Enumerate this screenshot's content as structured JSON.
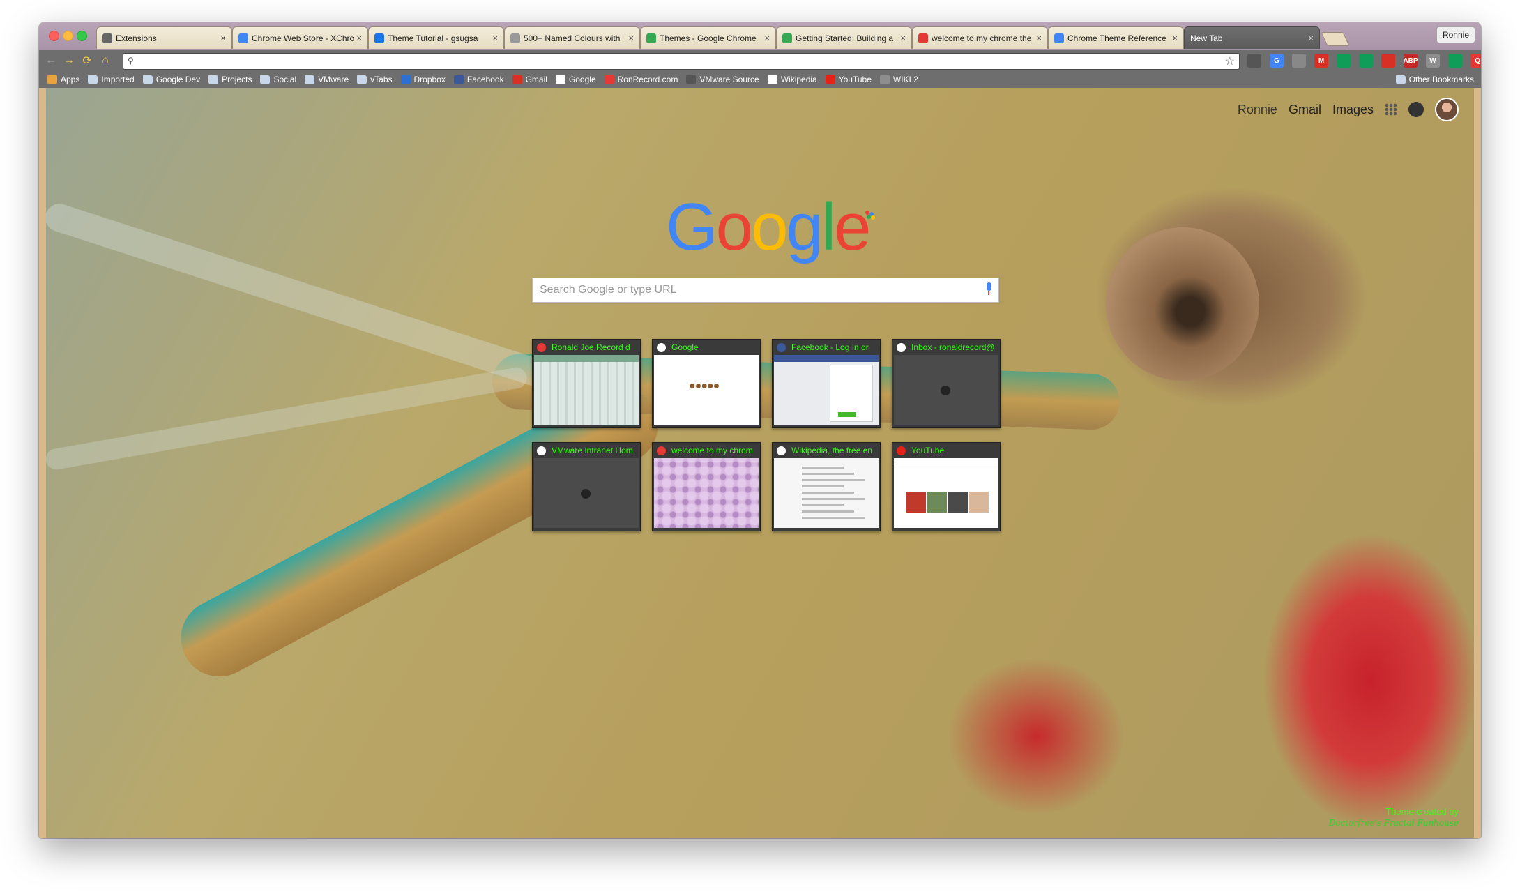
{
  "window": {
    "profile_label": "Ronnie",
    "tabs": [
      {
        "title": "Extensions",
        "favicon_icon": "puzzle-icon",
        "color": "#666666"
      },
      {
        "title": "Chrome Web Store - XChro",
        "favicon_icon": "chrome-icon",
        "color": "#4285f4"
      },
      {
        "title": "Theme Tutorial - gsugsa",
        "favicon_icon": "doc-icon",
        "color": "#1a73e8"
      },
      {
        "title": "500+ Named Colours with",
        "favicon_icon": "page-icon",
        "color": "#999999"
      },
      {
        "title": "Themes - Google Chrome",
        "favicon_icon": "google-icon",
        "color": "#34a853"
      },
      {
        "title": "Getting Started: Building a",
        "favicon_icon": "google-icon",
        "color": "#34a853"
      },
      {
        "title": "welcome to my chrome the",
        "favicon_icon": "record-icon",
        "color": "#e53935"
      },
      {
        "title": "Chrome Theme Reference",
        "favicon_icon": "doc-icon",
        "color": "#4285f4"
      },
      {
        "title": "New Tab",
        "favicon_icon": "",
        "color": "",
        "active": true
      }
    ]
  },
  "toolbar": {
    "omnibox_value": "",
    "extensions": [
      {
        "icon": "microphone-icon",
        "label": "",
        "color": "#555555"
      },
      {
        "icon": "translate-icon",
        "label": "G",
        "color": "#4285f4"
      },
      {
        "icon": "mail-icon",
        "label": "",
        "color": "#888888"
      },
      {
        "icon": "gmail-icon",
        "label": "M",
        "color": "#d93025"
      },
      {
        "icon": "drive-icon",
        "label": "",
        "color": "#0f9d58"
      },
      {
        "icon": "hangouts-icon",
        "label": "",
        "color": "#0f9d58"
      },
      {
        "icon": "clip-icon",
        "label": "",
        "color": "#d93025"
      },
      {
        "icon": "adblock-icon",
        "label": "ABP",
        "color": "#c62828"
      },
      {
        "icon": "word-icon",
        "label": "W",
        "color": "#8e8e8e"
      },
      {
        "icon": "sheets-icon",
        "label": "",
        "color": "#0f9d58"
      },
      {
        "icon": "search-ext-icon",
        "label": "Q",
        "color": "#e53935"
      },
      {
        "icon": "menu-icon",
        "label": "≡",
        "color": "#f0c44c"
      }
    ]
  },
  "bookmarks": {
    "items": [
      {
        "label": "Apps",
        "icon": "apps-grid-icon",
        "color": "#e8a33d"
      },
      {
        "label": "Imported",
        "icon": "folder-icon"
      },
      {
        "label": "Google Dev",
        "icon": "folder-icon"
      },
      {
        "label": "Projects",
        "icon": "folder-icon"
      },
      {
        "label": "Social",
        "icon": "folder-icon"
      },
      {
        "label": "VMware",
        "icon": "folder-icon"
      },
      {
        "label": "vTabs",
        "icon": "folder-icon"
      },
      {
        "label": "Dropbox",
        "icon": "dropbox-icon",
        "color": "#2e6fd3"
      },
      {
        "label": "Facebook",
        "icon": "facebook-icon",
        "color": "#3b5998"
      },
      {
        "label": "Gmail",
        "icon": "gmail-icon",
        "color": "#d93025"
      },
      {
        "label": "Google",
        "icon": "google-icon",
        "color": "#ffffff"
      },
      {
        "label": "RonRecord.com",
        "icon": "record-icon",
        "color": "#e53935"
      },
      {
        "label": "VMware Source",
        "icon": "vm-icon",
        "color": "#555555"
      },
      {
        "label": "Wikipedia",
        "icon": "wikipedia-icon",
        "color": "#ffffff"
      },
      {
        "label": "YouTube",
        "icon": "youtube-icon",
        "color": "#e62117"
      },
      {
        "label": "WIKI 2",
        "icon": "wiki2-icon",
        "color": "#8e8e8e"
      }
    ],
    "other_label": "Other Bookmarks"
  },
  "ntp": {
    "links": {
      "user": "Ronnie",
      "gmail": "Gmail",
      "images": "Images"
    },
    "logo_text": "Google",
    "search_placeholder": "Search Google or type URL",
    "tiles": [
      {
        "title": "Ronald Joe Record d",
        "icon": "record-icon",
        "icon_color": "#e53935",
        "thumb": "record"
      },
      {
        "title": "Google",
        "icon": "google-icon",
        "icon_color": "#ffffff",
        "thumb": "google"
      },
      {
        "title": "Facebook - Log In or",
        "icon": "facebook-icon",
        "icon_color": "#3b5998",
        "thumb": "fb"
      },
      {
        "title": "Inbox - ronaldrecord@",
        "icon": "google-icon",
        "icon_color": "#ffffff",
        "thumb": "dark"
      },
      {
        "title": "VMware Intranet Hom",
        "icon": "page-icon",
        "icon_color": "#ffffff",
        "thumb": "dark"
      },
      {
        "title": "welcome to my chrom",
        "icon": "record-icon",
        "icon_color": "#e53935",
        "thumb": "pattern"
      },
      {
        "title": "Wikipedia, the free en",
        "icon": "wikipedia-icon",
        "icon_color": "#ffffff",
        "thumb": "wiki"
      },
      {
        "title": "YouTube",
        "icon": "youtube-icon",
        "icon_color": "#e62117",
        "thumb": "yt"
      }
    ],
    "credit_line1": "Theme created by",
    "credit_line2": "Doctorfree's Fractal Funhouse"
  },
  "colors": {
    "accent_text": "#39ff14",
    "toolbar": "#6e6e6e",
    "tab_strip": "#a893a8"
  }
}
